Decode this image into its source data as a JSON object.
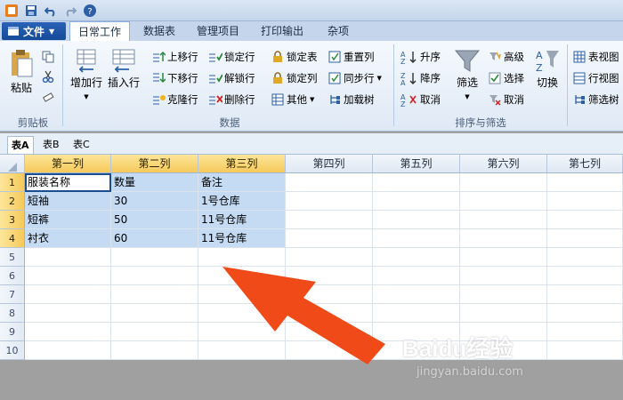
{
  "quick_access": [
    "save-icon",
    "undo-icon",
    "redo-icon",
    "help-icon"
  ],
  "file_menu": {
    "label": "文件"
  },
  "tabs": [
    "日常工作",
    "数据表",
    "管理项目",
    "打印输出",
    "杂项"
  ],
  "ribbon": {
    "clipboard": {
      "paste": "粘贴",
      "group_label": "剪贴板"
    },
    "data": {
      "add_row": "增加行",
      "insert_row": "插入行",
      "move_up": "上移行",
      "move_down": "下移行",
      "clone_row": "克隆行",
      "lock_row": "锁定行",
      "unlock_row": "解锁行",
      "delete_row": "删除行",
      "lock_table": "锁定表",
      "lock_col": "锁定列",
      "other": "其他",
      "reset_col": "重置列",
      "sync_row": "同步行",
      "load_tree": "加载树",
      "group_label": "数据"
    },
    "sort_filter": {
      "asc": "升序",
      "desc": "降序",
      "cancel": "取消",
      "filter": "筛选",
      "advanced": "高级",
      "select": "选择",
      "cancel2": "取消",
      "switch": "切换",
      "group_label": "排序与筛选"
    },
    "view": {
      "table_view": "表视图",
      "row_view": "行视图",
      "filter_tree": "筛选树"
    }
  },
  "sheet_tabs": [
    "表A",
    "表B",
    "表C"
  ],
  "columns": [
    "第一列",
    "第二列",
    "第三列",
    "第四列",
    "第五列",
    "第六列",
    "第七列"
  ],
  "rows": [
    [
      "服装名称",
      "数量",
      "备注"
    ],
    [
      "短袖",
      "30",
      "1号仓库"
    ],
    [
      "短裤",
      "50",
      "11号仓库"
    ],
    [
      "衬衣",
      "60",
      "11号仓库"
    ],
    [
      "",
      "",
      ""
    ],
    [
      "",
      "",
      ""
    ],
    [
      "",
      "",
      ""
    ],
    [
      "",
      "",
      ""
    ],
    [
      "",
      "",
      ""
    ],
    [
      "",
      "",
      ""
    ]
  ],
  "row_numbers": [
    "1",
    "2",
    "3",
    "4",
    "5",
    "6",
    "7",
    "8",
    "9",
    "10"
  ],
  "watermark": {
    "brand": "Baidu经验",
    "url": "jingyan.baidu.com"
  },
  "colors": {
    "arrow": "#f04a18",
    "selection": "#c5daf3",
    "header_selected": "#f6c95a"
  }
}
